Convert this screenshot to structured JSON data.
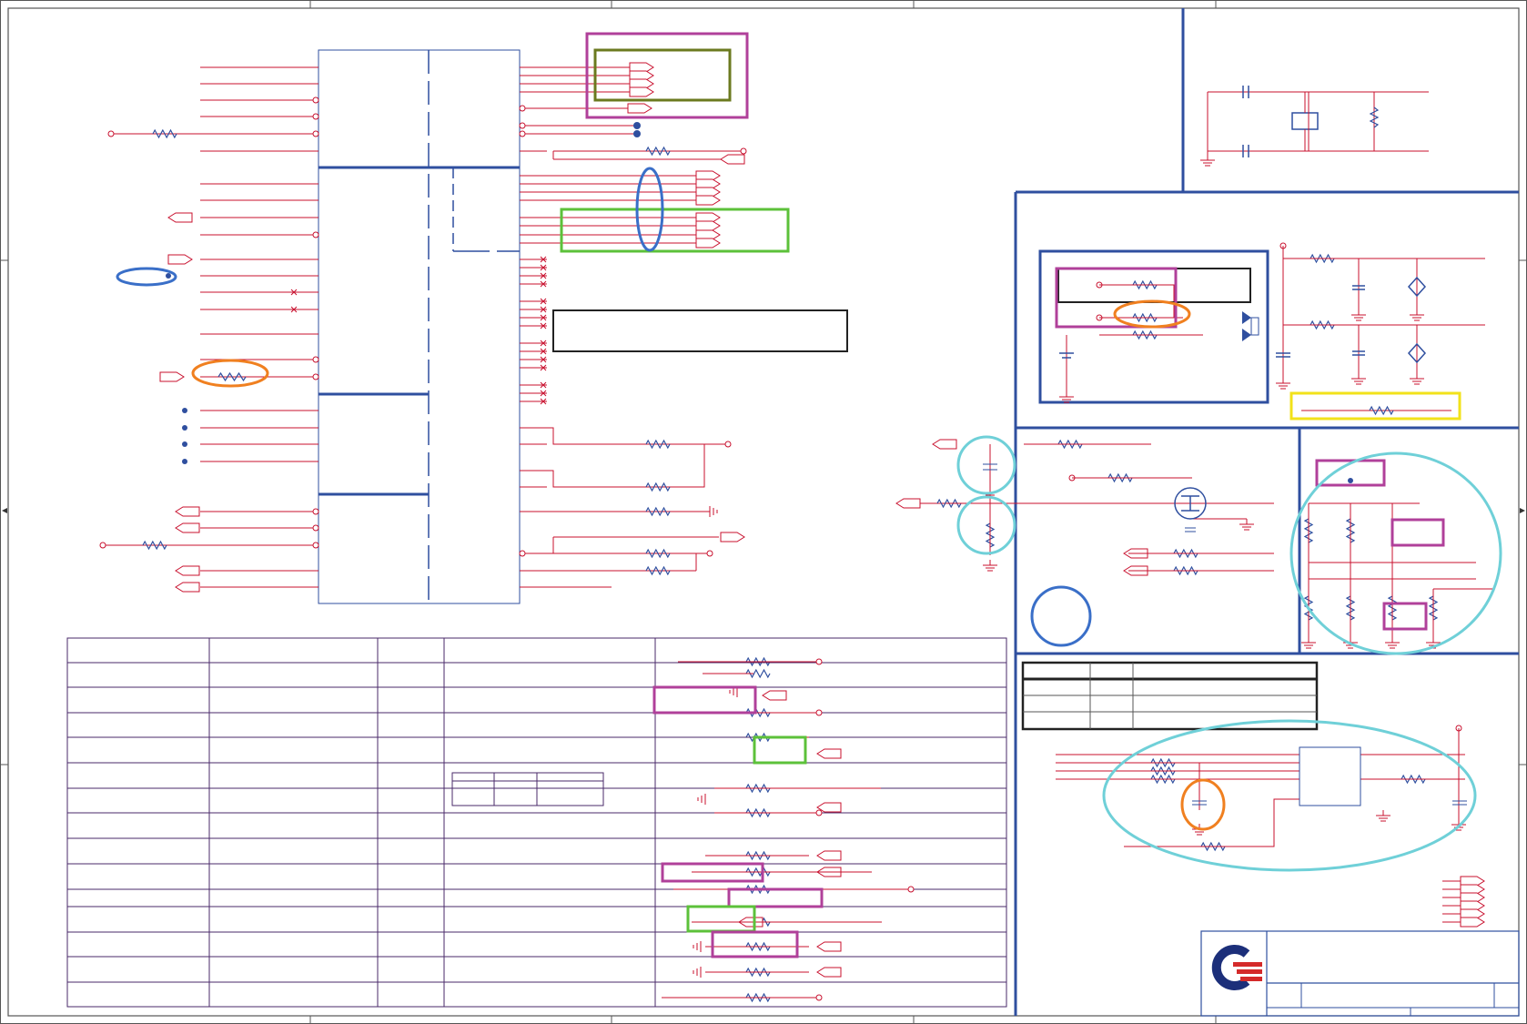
{
  "sheet": {
    "title": "",
    "subtitle": ""
  },
  "colors": {
    "wire": "#c8102e",
    "component": "#2f4f9f",
    "block_border": "#2f4f9f",
    "highlight_magenta": "#b0409a",
    "highlight_olive": "#6b7a1f",
    "highlight_green": "#5cc13a",
    "highlight_blue": "#3a6fc8",
    "highlight_orange": "#f08020",
    "highlight_cyan": "#6fd0d8",
    "highlight_yellow": "#f2e21a",
    "frame": "#555555",
    "logo_blue": "#1c2f7a",
    "logo_red": "#d42a2a"
  },
  "icons": {
    "logo": "company-logo-icon",
    "mosfet": "mosfet-icon",
    "diode": "diode-icon",
    "ground": "ground-icon",
    "resistor": "resistor-icon",
    "capacitor": "capacitor-icon",
    "crystal": "crystal-icon",
    "tvs": "tvs-diode-icon",
    "port": "port-arrow-icon"
  },
  "tables": {
    "strap_table_rows": 14,
    "strap_table_cols": 5,
    "mini_table_rows": 2,
    "mini_table_cols": 3,
    "bom_table_rows": 4,
    "bom_table_cols": 3
  }
}
